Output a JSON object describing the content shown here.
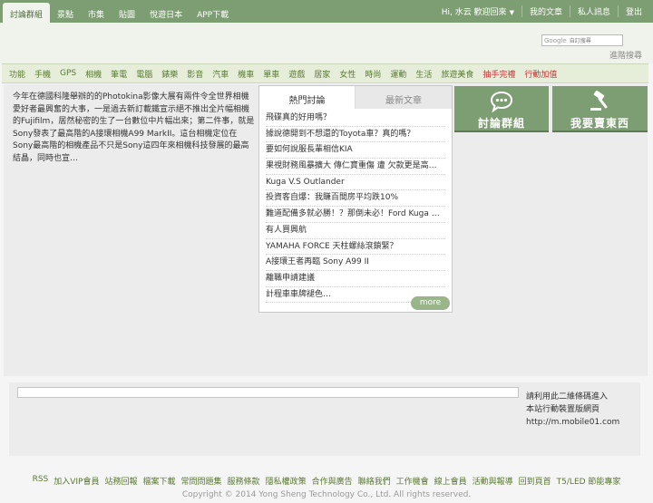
{
  "topnav": {
    "items": [
      "討論群組",
      "景點",
      "市集",
      "貼圖",
      "悅遊日本",
      "APP下載"
    ]
  },
  "user": {
    "greeting": "Hi, 水云 歡迎回來",
    "links": [
      "我的文章",
      "私人訊息",
      "登出"
    ]
  },
  "search": {
    "google_label": "Google",
    "placeholder": "自訂搜尋",
    "advanced": "進階搜尋"
  },
  "categories": {
    "items": [
      "功能",
      "手機",
      "GPS",
      "相機",
      "筆電",
      "電腦",
      "錶樂",
      "影音",
      "汽車",
      "機車",
      "單車",
      "遊戲",
      "居家",
      "女性",
      "時尚",
      "運動",
      "生活",
      "旅遊美食"
    ],
    "highlight": [
      "抽手完禮",
      "行動加值"
    ]
  },
  "intro_text": "今年在德國科隆舉辦的的Photokina影像大展有兩件令全世界相機愛好者最興奮的大事，一是過去新訂載鐵宣示絕不推出全片幅相機的Fujifilm，居然秘密的生了一台數位中片幅出來；第二件事，就是Sony發表了最高階的A接環相機A99 MarkII。這台相機定位在Sony最高階的相機產品不只是Sony這四年來相機科技發展的最高結晶，同時也宣…",
  "forum": {
    "tabs": [
      "熱門討論",
      "最新文章"
    ],
    "topics": [
      "飛碟真的好用嗎？",
      "據說德開到不想還的Toyota車？真的嗎？",
      "要如何說服長輩相信KIA",
      "果視財務風暴擴大 傳仁寶重傷 遭 欠款更是高…",
      "Kuga V.S Outlander",
      "投資客自爆：我賺百間房平均跌10%",
      "難道配備多就必勝！？那倒未必！Ford Kuga …",
      "有人買興航",
      "YAMAHA FORCE 天柱螺絲滾鎖緊？",
      "A接環王者再臨 Sony A99 II",
      "離職申請建議",
      "計程車車牌褪色…"
    ],
    "more": "more"
  },
  "buttons": {
    "group": "討論群組",
    "sell": "我要賣東西"
  },
  "qr_note": [
    "請利用此二維條碼進入",
    "本站行動裝置版網頁",
    "http://m.mobile01.com"
  ],
  "footer": {
    "links": [
      "RSS",
      "加入VIP會員",
      "站務回報",
      "檔案下載",
      "常問問題集",
      "服務條款",
      "隱私權政策",
      "合作與廣告",
      "聯絡我們",
      "工作機會",
      "線上會員",
      "活動與報導",
      "回到頁首",
      "T5/LED 節能專家"
    ],
    "copyright": "Copyright © 2014 Yong Sheng Technology Co., Ltd. All rights reserved."
  },
  "colors": {
    "topbar": "#7d9e72",
    "catbar": "#e6edd9",
    "accent_red": "#c83030"
  }
}
